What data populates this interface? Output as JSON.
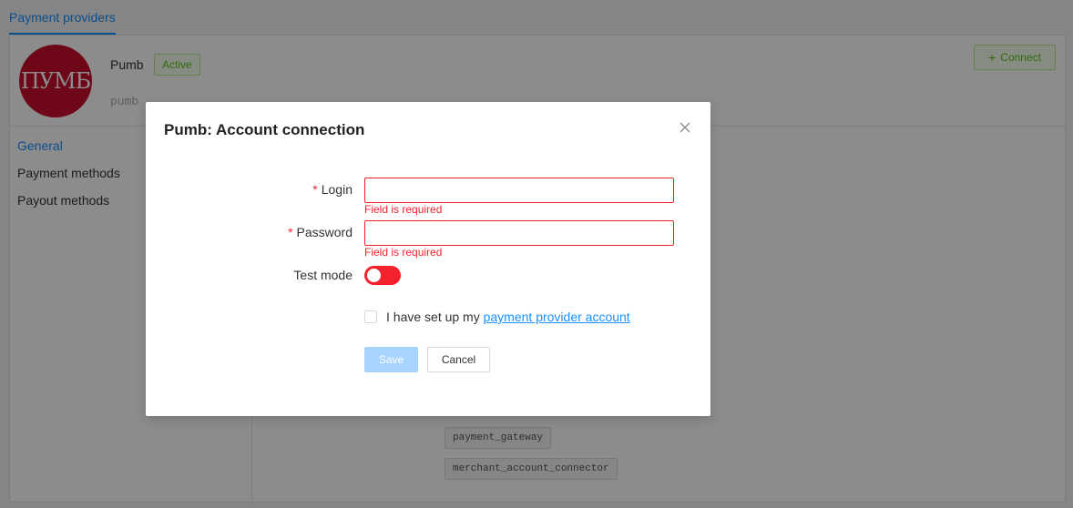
{
  "tabs": {
    "active_label": "Payment providers"
  },
  "provider": {
    "logo_text": "ПУМБ",
    "name": "Pumb",
    "status": "Active",
    "slug": "pumb",
    "connect_label": "Connect"
  },
  "sidebar": {
    "items": [
      {
        "label": "General",
        "active": true
      },
      {
        "label": "Payment methods",
        "active": false
      },
      {
        "label": "Payout methods",
        "active": false
      }
    ]
  },
  "content": {
    "tags": [
      "payment_gateway",
      "merchant_account_connector"
    ]
  },
  "modal": {
    "title": "Pumb: Account connection",
    "fields": [
      {
        "label": "Login",
        "required": true,
        "value": "",
        "error": "Field is required"
      },
      {
        "label": "Password",
        "required": true,
        "value": "",
        "error": "Field is required"
      }
    ],
    "test_mode": {
      "label": "Test mode",
      "on": false
    },
    "checkbox": {
      "checked": false,
      "text": "I have set up my",
      "link_text": "payment provider account"
    },
    "save_label": "Save",
    "cancel_label": "Cancel"
  },
  "colors": {
    "primary": "#1890ff",
    "error": "#f5222d",
    "success": "#52c41a",
    "logo_bg": "#c8102e"
  }
}
